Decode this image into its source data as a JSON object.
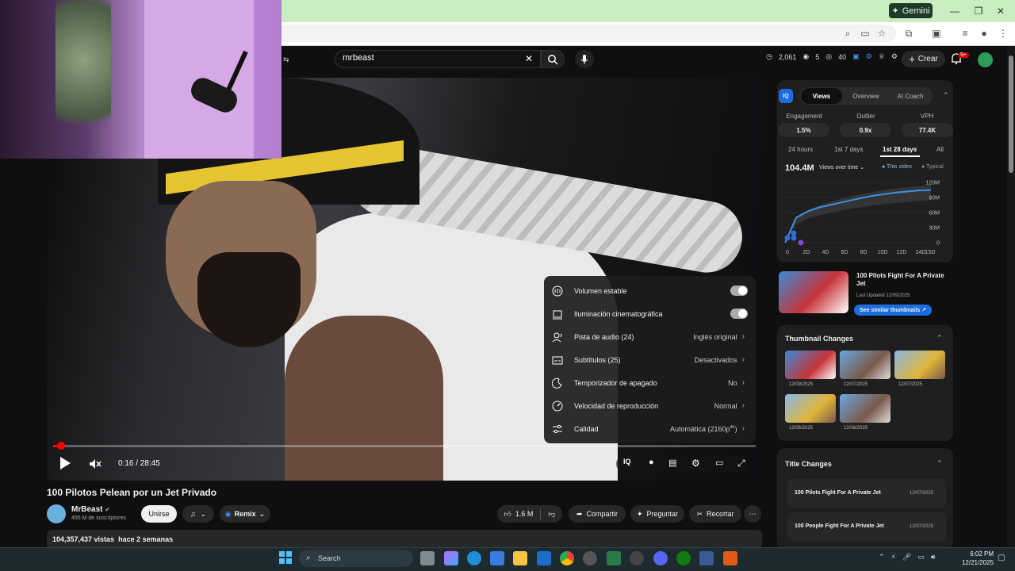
{
  "browser": {
    "gemini_label": "Gemini",
    "window_controls": {
      "minimize": "—",
      "restore": "❐",
      "close": "✕"
    }
  },
  "masthead": {
    "search_value": "mrbeast",
    "stats": {
      "count_a": "2,061",
      "count_b": "5",
      "count_c": "40"
    },
    "create_label": "Crear",
    "notif_badge": "9+"
  },
  "player": {
    "time": "0:16 / 28:45",
    "progress_fraction": 0.009,
    "settings": [
      {
        "label": "Volumen estable",
        "value": "",
        "type": "toggle",
        "icon": "stable-volume-icon"
      },
      {
        "label": "Iluminación cinematográfica",
        "value": "",
        "type": "toggle",
        "icon": "ambient-mode-icon"
      },
      {
        "label": "Pista de audio (24)",
        "value": "Inglés original",
        "type": "submenu",
        "icon": "audio-track-icon"
      },
      {
        "label": "Subtítulos (25)",
        "value": "Desactivados",
        "type": "submenu",
        "icon": "subtitles-icon"
      },
      {
        "label": "Temporizador de apagado",
        "value": "No",
        "type": "submenu",
        "icon": "sleep-timer-icon"
      },
      {
        "label": "Velocidad de reproducción",
        "value": "Normal",
        "type": "submenu",
        "icon": "playback-speed-icon"
      },
      {
        "label": "Calidad",
        "value": "Automática (2160p",
        "value_sup": "4K",
        "value_end": ")",
        "type": "submenu",
        "icon": "quality-icon"
      }
    ]
  },
  "video": {
    "title": "100 Pilotos Pelean por un Jet Privado",
    "channel": "MrBeast",
    "subscribers": "455 M de suscriptores",
    "join_label": "Unirse",
    "remix_label": "Remix",
    "likes": "1.6 M",
    "share_label": "Compartir",
    "ask_label": "Preguntar",
    "clip_label": "Recortar",
    "views_line": "104,357,437 vistas  hace 2 semanas"
  },
  "vidiq": {
    "logo": "IQ",
    "tabs": [
      "Views",
      "Overview",
      "AI Coach"
    ],
    "metrics": [
      {
        "label": "Engagement",
        "value": "1.5%"
      },
      {
        "label": "Outlier",
        "value": "0.9x"
      },
      {
        "label": "VPH",
        "value": "77.4K"
      }
    ],
    "ranges": [
      "24 hours",
      "1st 7 days",
      "1st 28 days",
      "All"
    ],
    "views_total": "104.4M",
    "views_dropdown": "Views over time",
    "legend_this": "This video",
    "legend_typical": "Typical",
    "y_ticks": [
      "120M",
      "90M",
      "60M",
      "30M",
      "0"
    ],
    "x_ticks": [
      "0",
      "2D",
      "4D",
      "6D",
      "8D",
      "10D",
      "12D",
      "14D",
      "15D"
    ],
    "this_video_series": [
      0,
      50,
      62,
      70,
      75,
      80,
      85,
      90,
      94,
      97,
      100,
      102,
      104,
      104.4
    ],
    "typical_series": [
      0,
      45,
      58,
      66,
      72,
      78,
      83,
      87,
      91,
      94,
      97,
      99,
      101,
      103
    ]
  },
  "thumb": {
    "title": "100 Pilots Fight For A Private Jet",
    "updated": "Last Updated 12/09/2025",
    "similar_label": "See similar thumbnails ↗"
  },
  "thumbnail_changes": {
    "title": "Thumbnail Changes",
    "dates": [
      "12/09/2025",
      "12/07/2025",
      "12/07/2025",
      "12/06/2025",
      "12/06/2025"
    ]
  },
  "title_changes": {
    "title": "Title Changes",
    "rows": [
      {
        "text": "100 Pilots Fight For A Private Jet",
        "date": "12/07/2025"
      },
      {
        "text": "100 People Fight For A Private Jet",
        "date": "12/07/2025"
      }
    ]
  },
  "taskbar": {
    "search_placeholder": "Search",
    "time": "6:02 PM",
    "date": "12/21/2025"
  },
  "colors": {
    "accent": "#1c6ee0",
    "youtube_red": "#ff0000",
    "titlebar": "#c9ecc0"
  }
}
